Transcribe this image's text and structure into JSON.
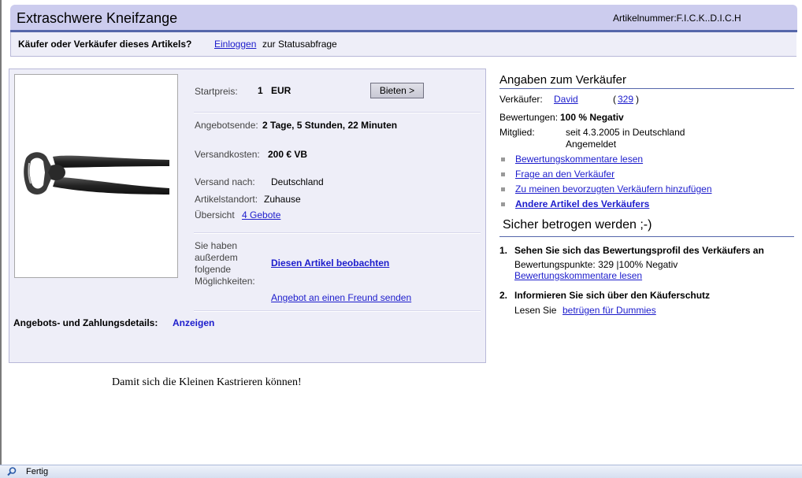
{
  "header": {
    "title": "Extraschwere Kneifzange",
    "article_number": "Artikelnummer:F.I.C.K..D.I.C.H"
  },
  "status": {
    "question": "Käufer oder Verkäufer dieses Artikels?",
    "login_label": "Einloggen",
    "rest": "zur Statusabfrage"
  },
  "item": {
    "start_price_label": "Startpreis:",
    "start_price_value": "1",
    "start_price_currency": "EUR",
    "bid_button": "Bieten >",
    "end_label": "Angebotsende:",
    "end_value": "2 Tage, 5 Stunden, 22 Minuten",
    "shipping_cost_label": "Versandkosten:",
    "shipping_cost_value": "200 € VB",
    "ship_to_label": "Versand nach:",
    "ship_to_value": "Deutschland",
    "location_label": "Artikelstandort:",
    "location_value": "Zuhause",
    "overview_label": "Übersicht",
    "overview_link": "4 Gebote",
    "options_label": "Sie haben außerdem folgende Möglichkeiten:",
    "watch_link": "Diesen Artikel beobachten",
    "friend_link": "Angebot an einen Freund senden",
    "payment_label": "Angebots- und Zahlungsdetails:",
    "payment_link": "Anzeigen"
  },
  "note": "Damit sich die Kleinen Kastrieren können!",
  "seller": {
    "heading": "Angaben zum Verkäufer",
    "seller_label": "Verkäufer:",
    "seller_name": "David",
    "paren_open": "(",
    "rating_count": "329",
    "paren_close": ")",
    "ratings_label": "Bewertungen:",
    "ratings_value": "100 % Negativ",
    "member_label": "Mitglied:",
    "member_line1": "seit  4.3.2005 in Deutschland",
    "member_line2": "Angemeldet",
    "links": [
      "Bewertungskommentare lesen",
      "Frage an den Verkäufer",
      "Zu meinen bevorzugten Verkäufern hinzufügen",
      "Andere Artikel des Verkäufers"
    ]
  },
  "safety": {
    "heading": "Sicher betrogen werden ;-)",
    "item1_num": "1.",
    "item1_title": "Sehen Sie sich das Bewertungsprofil des Verkäufers an",
    "item1_points": "Bewertungspunkte: 329 |100% Negativ",
    "item1_link": "Bewertungskommentare lesen",
    "item2_num": "2.",
    "item2_title": "Informieren Sie sich über den Käuferschutz",
    "item2_prefix": "Lesen Sie",
    "item2_link": "betrügen für Dummies"
  },
  "browser": {
    "status_text": "Fertig"
  },
  "colors": {
    "header_bg": "#ccccee",
    "panel_bg": "#eeeef8",
    "link": "#1c1ccc",
    "rule": "#5566aa"
  }
}
